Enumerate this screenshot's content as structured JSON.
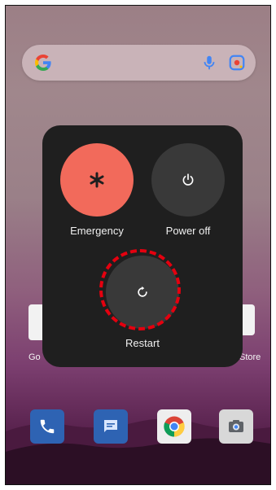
{
  "search": {
    "logo": "google-g-icon",
    "mic": "mic-icon",
    "lens": "lens-icon"
  },
  "power_menu": {
    "emergency_label": "Emergency",
    "power_off_label": "Power off",
    "restart_label": "Restart",
    "emergency_color": "#f26a5b"
  },
  "background": {
    "left_widget_label": "Go",
    "right_widget_label": "Store"
  },
  "dock": {
    "apps": [
      "phone",
      "messages",
      "chrome",
      "camera"
    ]
  },
  "annotation": {
    "highlight_color": "#e4000f"
  }
}
